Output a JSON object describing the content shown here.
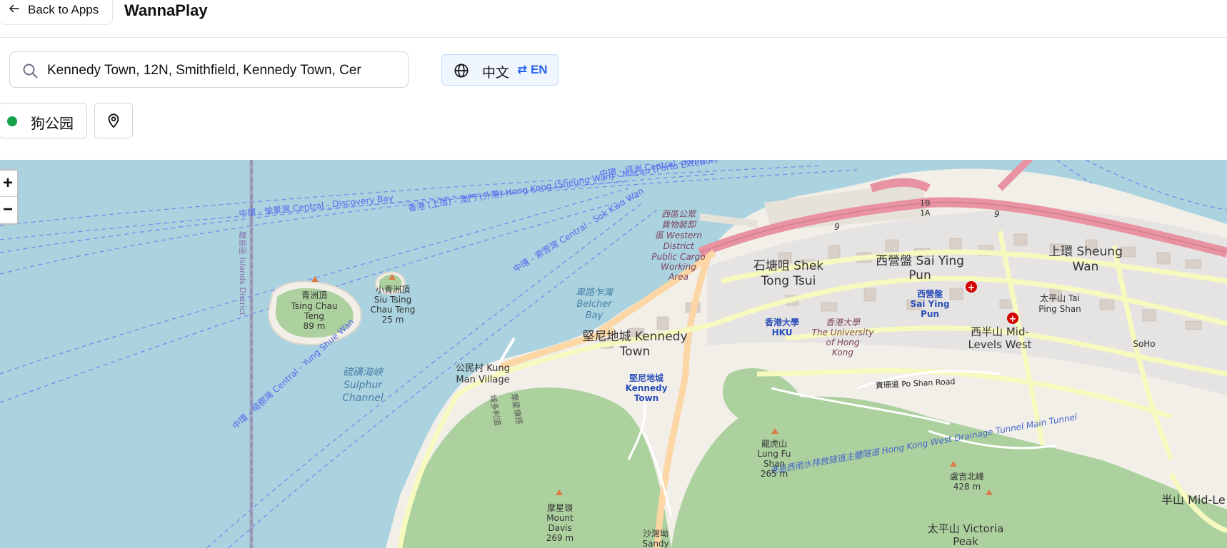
{
  "header": {
    "back_label": "Back to Apps",
    "app_title": "WannaPlay"
  },
  "search": {
    "value": "Kennedy Town, 12N, Smithfield, Kennedy Town, Cer",
    "icon": "search-icon"
  },
  "language": {
    "current": "中文",
    "switch_label": "⇄ EN",
    "icon": "globe-icon"
  },
  "filters": {
    "chip_label": "狗公园",
    "chip_color": "#16a34a",
    "locate_icon": "map-pin-icon"
  },
  "map": {
    "zoom_in": "+",
    "zoom_out": "−",
    "colors": {
      "water": "#aad3df",
      "land": "#f2efe9",
      "park": "#add19e",
      "road_major": "#f7fabf",
      "motorway": "#e892a2"
    },
    "labels": {
      "central_discovery": "中環 - 愉景灣 Central - Discovery Bay",
      "macau_ferry": "香港 (上環) - 澳門 (外港) Hong Kong (Sheung Wan) - Macau (Porto Exterior)",
      "peng_chau": "中環 - 坪洲 Central - Peng Ch",
      "sok_kwu_wan": "中環 - 索罟灣 Central - Sok Kwu Wan",
      "yung_shue_wan": "中環 - 榕樹灣 Central - Yung Shue Wan",
      "islands_district": "離島區 Islands District",
      "western_cargo_1": "西區公眾",
      "western_cargo_2": "貨物裝卸",
      "western_cargo_3": "區 Western",
      "western_cargo_4": "District",
      "western_cargo_5": "Public Cargo",
      "western_cargo_6": "Working",
      "western_cargo_7": "Area",
      "belcher_bay_1": "卑路乍灣",
      "belcher_bay_2": "Belcher",
      "belcher_bay_3": "Bay",
      "tsing_chau_1": "青洲頂",
      "tsing_chau_2": "Tsing Chau",
      "tsing_chau_3": "Teng",
      "tsing_chau_4": "89 m",
      "siu_tsing_1": "小青洲頂",
      "siu_tsing_2": "Siu Tsing",
      "siu_tsing_3": "Chau Teng",
      "siu_tsing_4": "25 m",
      "sulphur_1": "硫磺海峽",
      "sulphur_2": "Sulphur",
      "sulphur_3": "Channel",
      "kennedy_town_1": "堅尼地城 Kennedy",
      "kennedy_town_2": "Town",
      "kt_station_1": "堅尼地城",
      "kt_station_2": "Kennedy",
      "kt_station_3": "Town",
      "kung_man_1": "公民村 Kung",
      "kung_man_2": "Man Village",
      "shek_tong_tsui_1": "石塘咀 Shek",
      "shek_tong_tsui_2": "Tong Tsui",
      "sai_ying_pun_1": "西營盤 Sai Ying",
      "sai_ying_pun_2": "Pun",
      "syp_station_1": "西營盤",
      "syp_station_2": "Sai Ying",
      "syp_station_3": "Pun",
      "hku_station_1": "香港大學",
      "hku_station_2": "HKU",
      "hku_1": "香港大學",
      "hku_2": "The University",
      "hku_3": "of Hong",
      "hku_4": "Kong",
      "sheung_wan_1": "上環 Sheung",
      "sheung_wan_2": "Wan",
      "tai_ping_shan_1": "太平山 Tai",
      "tai_ping_shan_2": "Ping Shan",
      "mid_levels_west_1": "西半山 Mid-",
      "mid_levels_west_2": "Levels West",
      "soho": "SoHo",
      "po_shan_road": "寶珊道 Po Shan Road",
      "drainage_tunnel": "港島西雨水排放隧道主體隧道 Hong Kong West Drainage Tunnel Main Tunnel",
      "lung_fu_1": "龍虎山",
      "lung_fu_2": "Lung Fu",
      "lung_fu_3": "Shan",
      "lung_fu_4": "265 m",
      "lo_kwai_1": "盧吉北峰",
      "lo_kwai_2": "428 m",
      "mount_davis_1": "摩星嶺",
      "mount_davis_2": "Mount",
      "mount_davis_3": "Davis",
      "mount_davis_4": "269 m",
      "victoria_peak_1": "太平山 Victoria",
      "victoria_peak_2": "Peak",
      "mid_levels_e": "半山 Mid-Le",
      "sandy_1": "沙灣坳",
      "sandy_2": "Sandy",
      "route_1b": "1B",
      "route_1a": "1A",
      "route_9a": "9",
      "route_9b": "9",
      "road_label_1": "域多利道",
      "road_label_2": "摩星嶺徑"
    }
  }
}
